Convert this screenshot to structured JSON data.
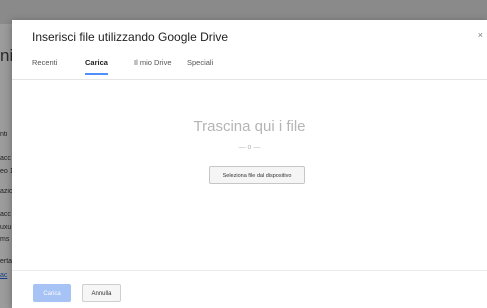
{
  "background": {
    "fragments": [
      "ni",
      "nti",
      "acc",
      "eo 1",
      "azio",
      "acc",
      "uxu",
      "ms",
      "erta",
      "ac"
    ]
  },
  "dialog": {
    "title": "Inserisci file utilizzando Google Drive",
    "close_symbol": "×",
    "tabs": [
      {
        "label": "Recenti",
        "active": false
      },
      {
        "label": "Carica",
        "active": true
      },
      {
        "label": "Il mio Drive",
        "active": false
      },
      {
        "label": "Speciali",
        "active": false
      }
    ],
    "drop_title": "Trascina qui i file",
    "or_text": "— o —",
    "select_button": "Seleziona file dal dispositivo",
    "footer": {
      "upload_button": "Carica",
      "cancel_button": "Annulla"
    }
  },
  "colors": {
    "accent": "#4d90fe",
    "upload_disabled": "#a7c2f5"
  }
}
